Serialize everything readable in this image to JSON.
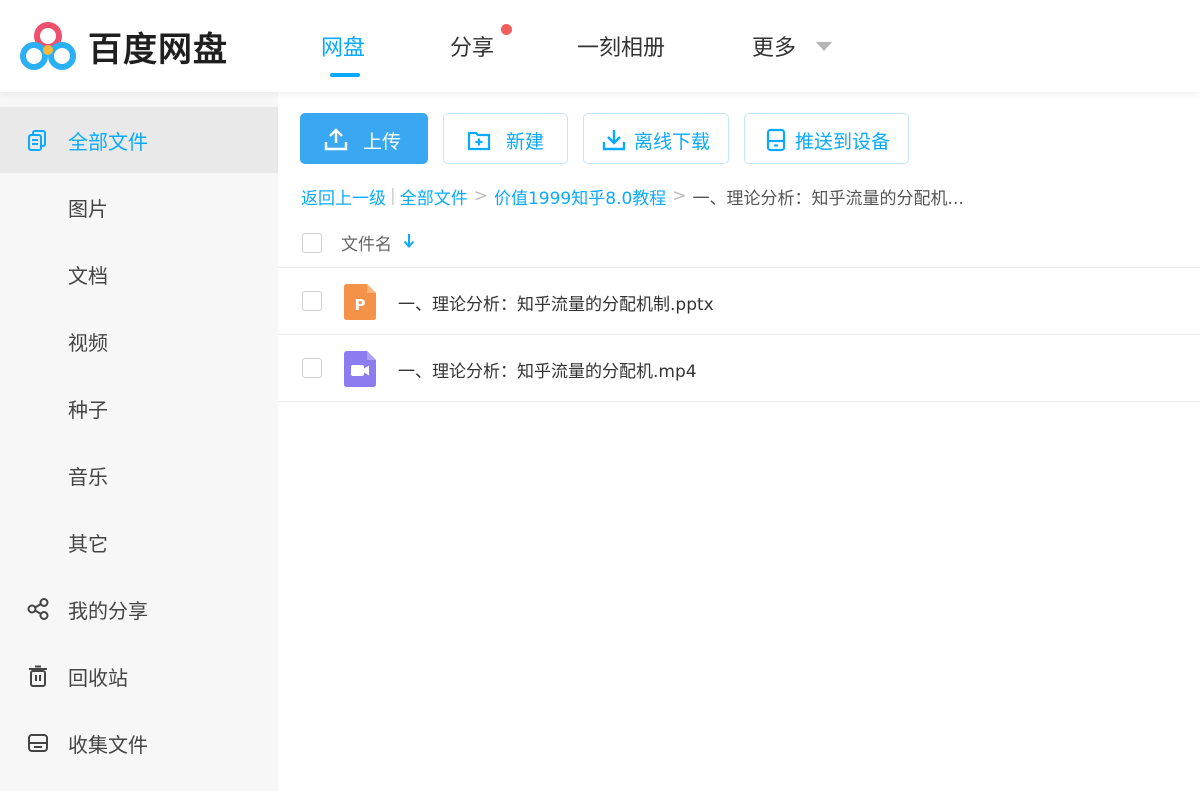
{
  "app": {
    "brand": "百度网盘",
    "colors": {
      "accent": "#09aaff",
      "primary_button": "#3aa7f2",
      "notify_dot": "#f25d5d",
      "ppt_icon": "#f5924a",
      "video_icon": "#8b7cf0"
    }
  },
  "nav": {
    "tabs": [
      {
        "label": "网盘",
        "active": true
      },
      {
        "label": "分享",
        "badge": "red-dot"
      },
      {
        "label": "一刻相册"
      },
      {
        "label": "更多",
        "icon": "chevron-down-icon"
      }
    ]
  },
  "sidebar": {
    "items": [
      {
        "label": "全部文件",
        "icon": "all-files-icon",
        "selected": true
      },
      {
        "label": "图片"
      },
      {
        "label": "文档"
      },
      {
        "label": "视频"
      },
      {
        "label": "种子"
      },
      {
        "label": "音乐"
      },
      {
        "label": "其它"
      },
      {
        "label": "我的分享",
        "icon": "share-icon"
      },
      {
        "label": "回收站",
        "icon": "trash-icon"
      },
      {
        "label": "收集文件",
        "icon": "inbox-icon"
      }
    ]
  },
  "toolbar": {
    "upload": {
      "label": "上传",
      "icon": "upload-icon"
    },
    "new": {
      "label": "新建",
      "icon": "new-folder-icon"
    },
    "offline": {
      "label": "离线下载",
      "icon": "download-icon"
    },
    "push": {
      "label": "推送到设备",
      "icon": "device-icon"
    }
  },
  "breadcrumb": {
    "back": "返回上一级",
    "separator": ">",
    "items": [
      "全部文件",
      "价值1999知乎8.0教程"
    ],
    "current": "一、理论分析：知乎流量的分配机..."
  },
  "list": {
    "header": {
      "name": "文件名",
      "sort_icon": "sort-down-icon"
    },
    "files": [
      {
        "name": "一、理论分析：知乎流量的分配机制.pptx",
        "type_icon": "ppt-file-icon",
        "icon_letter": "P"
      },
      {
        "name": "一、理论分析：知乎流量的分配机.mp4",
        "type_icon": "video-file-icon"
      }
    ]
  }
}
